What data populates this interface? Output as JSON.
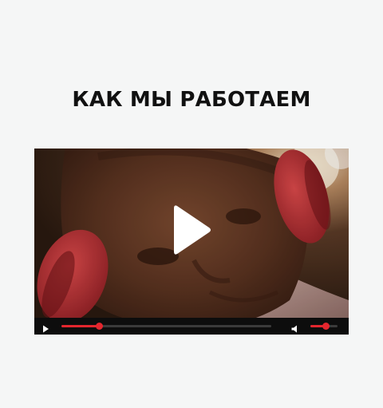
{
  "section": {
    "title": "КАК МЫ РАБОТАЕМ"
  },
  "video": {
    "play_icon": "play-icon",
    "progress": 0.18,
    "volume": 0.55,
    "colors": {
      "accent": "#e3262e",
      "controls_bg": "#0d0d0d",
      "track": "#3a3a3a"
    },
    "controls": {
      "play_icon": "play-icon",
      "volume_icon": "volume-icon"
    }
  }
}
